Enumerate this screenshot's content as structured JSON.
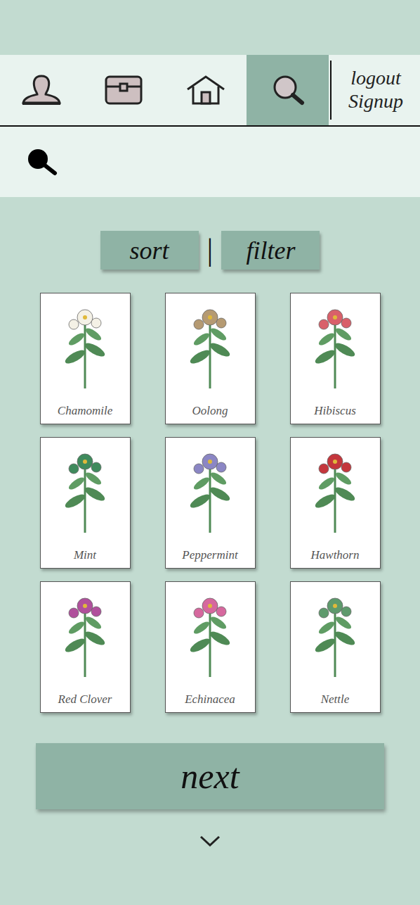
{
  "nav": {
    "tabs": [
      {
        "kind": "profile",
        "selected": false
      },
      {
        "kind": "inventory",
        "selected": false
      },
      {
        "kind": "home",
        "selected": false
      },
      {
        "kind": "search",
        "selected": true
      }
    ],
    "auth": [
      "logout",
      "Signup"
    ]
  },
  "search": {
    "placeholder": ""
  },
  "controls": {
    "sort": "sort",
    "separator": "|",
    "filter": "filter"
  },
  "cards": [
    {
      "name": "Chamomile",
      "color": "#f4f1e6"
    },
    {
      "name": "Oolong",
      "color": "#b59a72"
    },
    {
      "name": "Hibiscus",
      "color": "#d9606a"
    },
    {
      "name": "Mint",
      "color": "#3f8a5c"
    },
    {
      "name": "Peppermint",
      "color": "#8b86c4"
    },
    {
      "name": "Hawthorn",
      "color": "#c4363c"
    },
    {
      "name": "Red Clover",
      "color": "#b0509c"
    },
    {
      "name": "Echinacea",
      "color": "#d6689e"
    },
    {
      "name": "Nettle",
      "color": "#5e9a6c"
    }
  ],
  "next": {
    "label": "next"
  }
}
